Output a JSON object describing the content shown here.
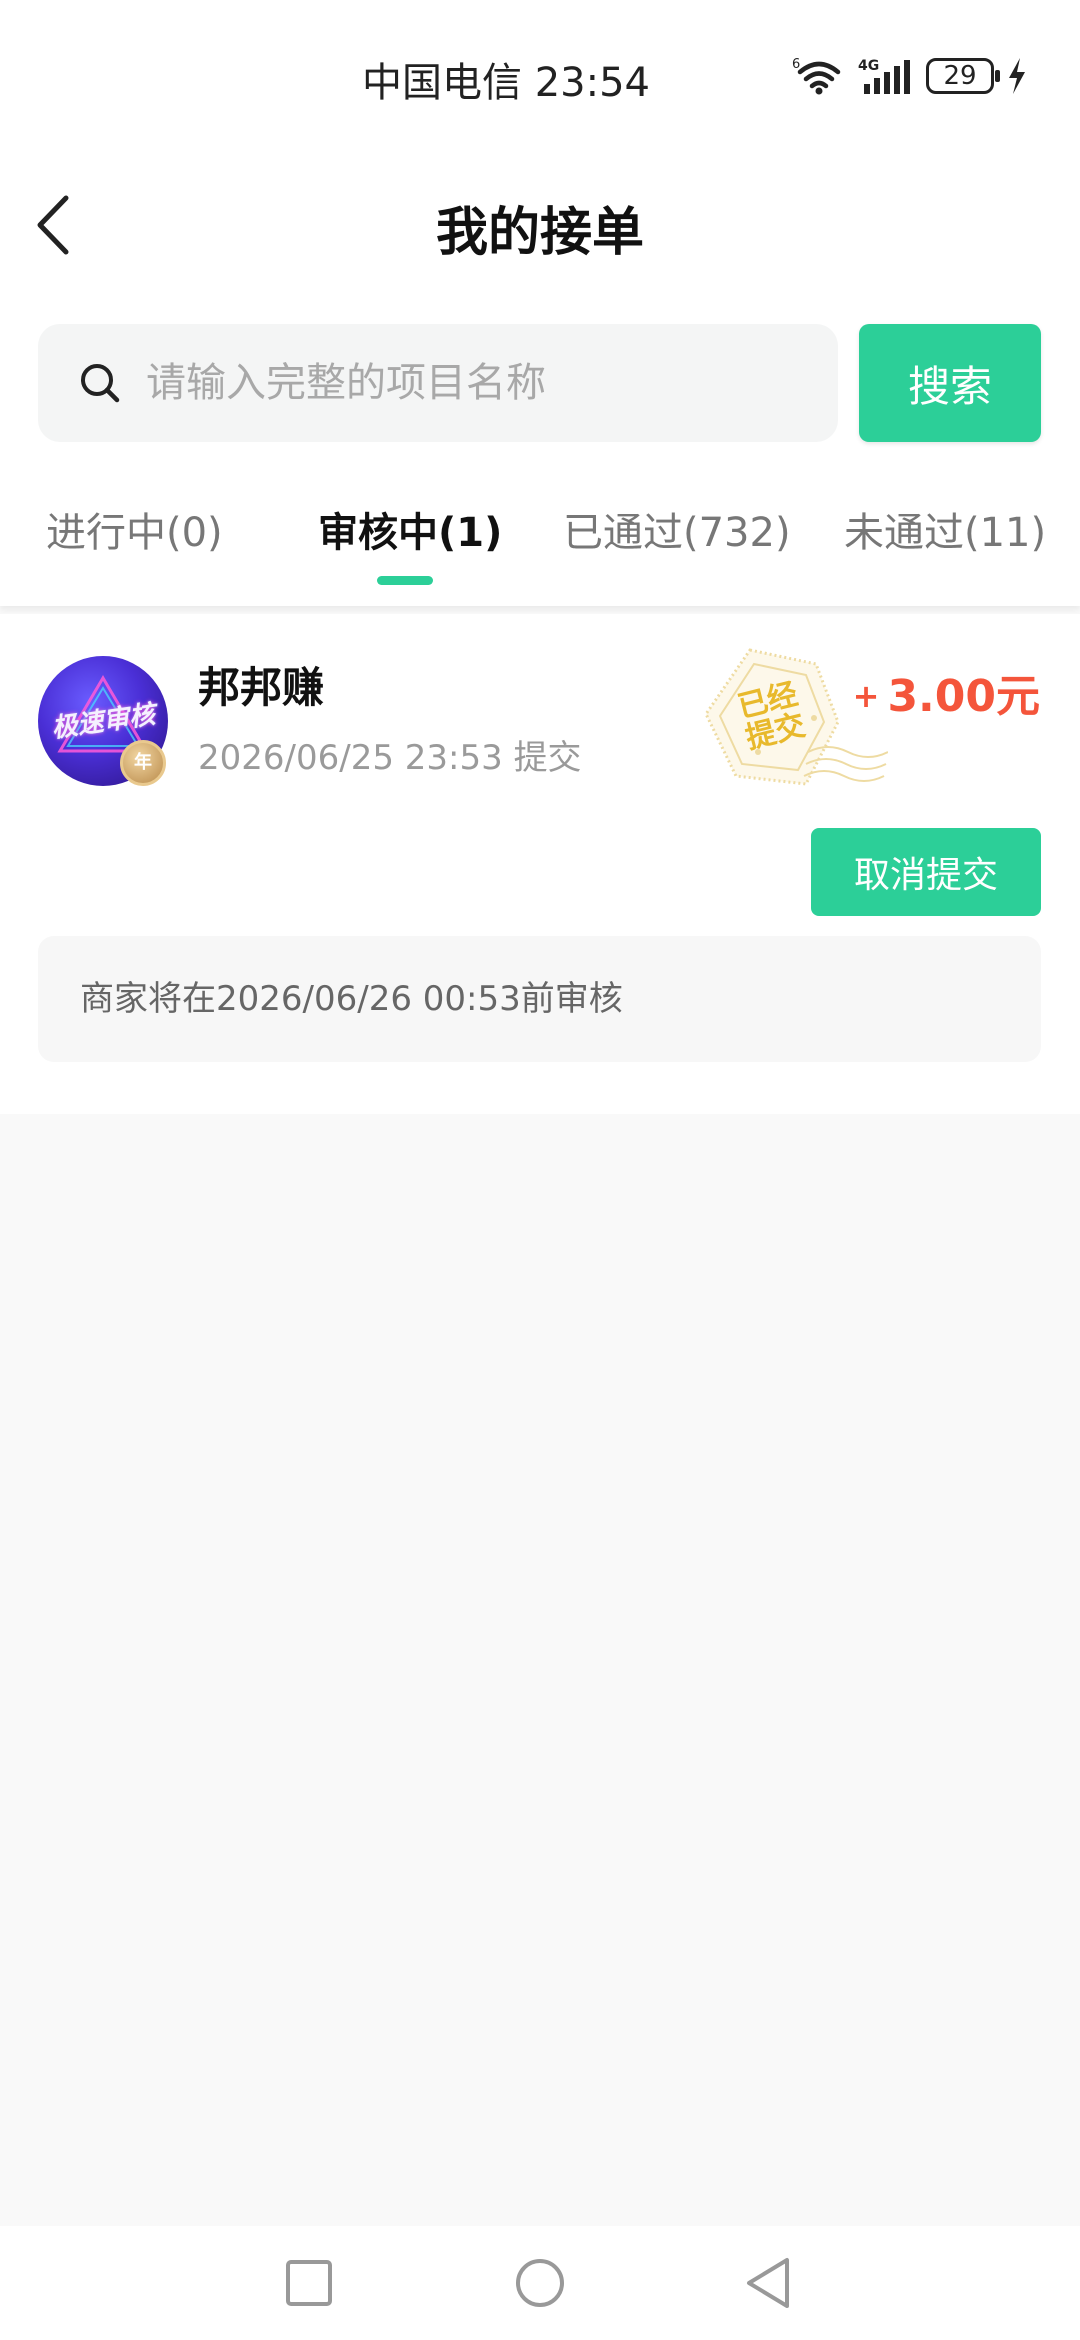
{
  "status_bar": {
    "carrier_time": "中国电信 23:54",
    "battery": "29",
    "icons": [
      "wifi-icon",
      "signal-4g-icon",
      "battery-icon",
      "charging-icon"
    ]
  },
  "header": {
    "title": "我的接单",
    "back_icon": "chevron-left-icon"
  },
  "search": {
    "placeholder": "请输入完整的项目名称",
    "value": "",
    "button_label": "搜索",
    "icon": "search-icon"
  },
  "tabs": [
    {
      "label": "进行中(0)",
      "active": false
    },
    {
      "label": "审核中(1)",
      "active": true
    },
    {
      "label": "已通过(732)",
      "active": false
    },
    {
      "label": "未通过(11)",
      "active": false
    }
  ],
  "task": {
    "avatar_text": "极速审核",
    "badge_text": "年",
    "name": "邦邦赚",
    "time": "2026/06/25 23:53 提交",
    "stamp_line1": "已经",
    "stamp_line2": "提交",
    "amount_plus": "+",
    "amount": "3.00元",
    "cancel_label": "取消提交",
    "notice": "商家将在2026/06/26 00:53前审核"
  },
  "nav": {
    "icons": [
      "square-recents-icon",
      "circle-home-icon",
      "triangle-back-icon"
    ]
  },
  "colors": {
    "accent": "#2ccf98",
    "amount": "#f4553b",
    "stamp": "#e8b92c"
  }
}
